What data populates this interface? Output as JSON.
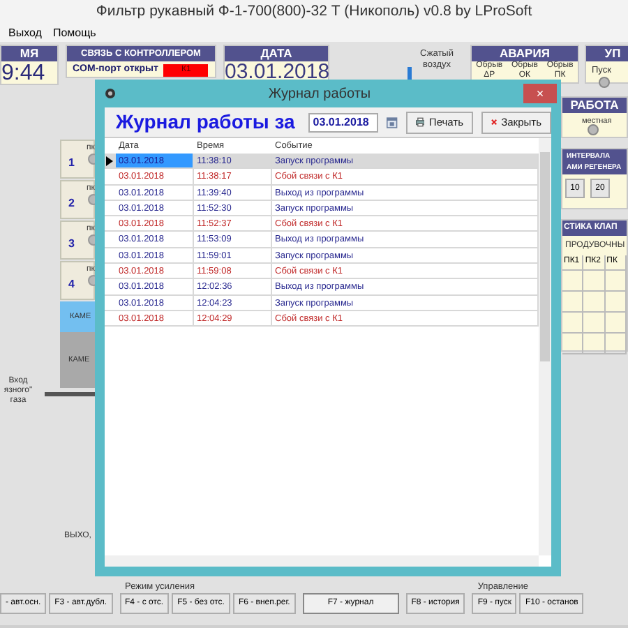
{
  "window": {
    "title": "Фильтр рукавный Ф-1-700(800)-32 Т (Никополь) v0.8 by LProSoft"
  },
  "menu": [
    "Выход",
    "Помощь"
  ],
  "time_panel": {
    "header": "МЯ",
    "value": "9:44"
  },
  "link_panel": {
    "header": "СВЯЗЬ С КОНТРОЛЛЕРОМ",
    "status": "COM-порт открыт",
    "indicator": "К1"
  },
  "date_panel": {
    "header": "ДАТА",
    "value": "03.01.2018"
  },
  "air": {
    "label": "Сжатый воздух"
  },
  "alarm_panel": {
    "header": "АВАРИЯ",
    "items": [
      "Обрыв ΔР",
      "Обрыв ОК",
      "Обрыв ПК"
    ]
  },
  "control_panel": {
    "header": "УП",
    "items": [
      "Пуск"
    ]
  },
  "work_panel": {
    "header": "РАБОТА",
    "items": [
      "местная"
    ]
  },
  "interval_panel": {
    "header_lines": [
      "ИНТЕРВАЛА",
      "АМИ РЕГЕНЕРА"
    ],
    "buttons": [
      "10",
      "20"
    ]
  },
  "valves_panel": {
    "header": "СТИКА КЛАП",
    "subheader": "ПРОДУВОЧНЫ",
    "columns": [
      "ПК1",
      "ПК2",
      "ПК"
    ]
  },
  "sections": [
    {
      "number": "1",
      "label": "пк"
    },
    {
      "number": "2",
      "label": "пк"
    },
    {
      "number": "3",
      "label": "пк"
    },
    {
      "number": "4",
      "label": "пк"
    }
  ],
  "chambers": [
    "КАМЕ",
    "КАМЕ"
  ],
  "inlet": {
    "lines": [
      "Вход",
      "язного\"",
      "газа"
    ]
  },
  "outlet": {
    "label": "ВЫХО,"
  },
  "bottom": {
    "groups": [
      {
        "buttons": [
          {
            "text": "- авт.осн.",
            "pressed": false
          },
          {
            "text": "F3 - авт.дубл.",
            "pressed": false
          }
        ]
      },
      {
        "label": "Режим усиления",
        "buttons": [
          {
            "text": "F4 - с отс.",
            "pressed": false
          },
          {
            "text": "F5 - без отс.",
            "pressed": false
          },
          {
            "text": "F6 - внеп.рег.",
            "pressed": false
          }
        ]
      },
      {
        "buttons": [
          {
            "text": "F7 - журнал",
            "pressed": true
          }
        ]
      },
      {
        "buttons": [
          {
            "text": "F8 - история",
            "pressed": false
          }
        ]
      },
      {
        "label": "Управление",
        "buttons": [
          {
            "text": "F9 - пуск",
            "pressed": false
          },
          {
            "text": "F10 - останов",
            "pressed": false
          }
        ]
      }
    ]
  },
  "dialog": {
    "title": "Журнал работы",
    "close_glyph": "×",
    "heading": "Журнал работы за",
    "date": "03.01.2018",
    "print_button": "Печать",
    "close_button": "Закрыть",
    "columns": [
      "Дата",
      "Время",
      "Событие"
    ],
    "rows": [
      {
        "date": "03.01.2018",
        "time": "11:38:10",
        "event": "Запуск программы",
        "kind": "info",
        "selected": true
      },
      {
        "date": "03.01.2018",
        "time": "11:38:17",
        "event": "Сбой связи с К1",
        "kind": "error",
        "selected": false
      },
      {
        "date": "03.01.2018",
        "time": "11:39:40",
        "event": "Выход из программы",
        "kind": "info",
        "selected": false
      },
      {
        "date": "03.01.2018",
        "time": "11:52:30",
        "event": "Запуск программы",
        "kind": "info",
        "selected": false
      },
      {
        "date": "03.01.2018",
        "time": "11:52:37",
        "event": "Сбой связи с К1",
        "kind": "error",
        "selected": false
      },
      {
        "date": "03.01.2018",
        "time": "11:53:09",
        "event": "Выход из программы",
        "kind": "info",
        "selected": false
      },
      {
        "date": "03.01.2018",
        "time": "11:59:01",
        "event": "Запуск программы",
        "kind": "info",
        "selected": false
      },
      {
        "date": "03.01.2018",
        "time": "11:59:08",
        "event": "Сбой связи с К1",
        "kind": "error",
        "selected": false
      },
      {
        "date": "03.01.2018",
        "time": "12:02:36",
        "event": "Выход из программы",
        "kind": "info",
        "selected": false
      },
      {
        "date": "03.01.2018",
        "time": "12:04:23",
        "event": "Запуск программы",
        "kind": "info",
        "selected": false
      },
      {
        "date": "03.01.2018",
        "time": "12:04:29",
        "event": "Сбой связи с К1",
        "kind": "error",
        "selected": false
      }
    ]
  }
}
